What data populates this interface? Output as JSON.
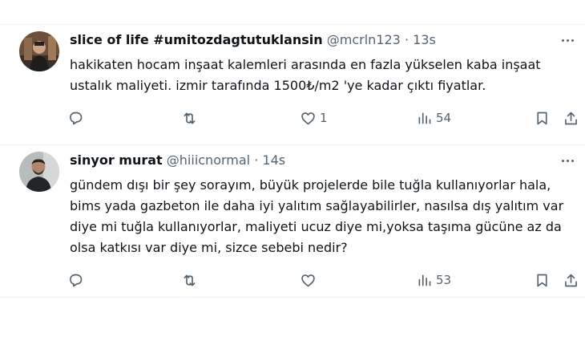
{
  "tweets": [
    {
      "display_name": "slice of life #umitozdagtutuklansin",
      "handle": "@mcrln123",
      "dot": "·",
      "time": "13s",
      "text_line1": "hakikaten hocam inşaat kalemleri arasında en fazla yükselen kaba inşaat",
      "text_line2": "ustalık maliyeti. izmir tarafında 1500₺/m2 'ye kadar çıktı fiyatlar.",
      "replies": "",
      "retweets": "",
      "likes": "1",
      "views": "54"
    },
    {
      "display_name": "sinyor murat",
      "handle": "@hiiicnormal",
      "dot": "·",
      "time": "14s",
      "text_line1": "gündem dışı bir şey sorayım, büyük projelerde bile tuğla kullanıyorlar hala,",
      "text_line2": "bims yada gazbeton ile daha iyi yalıtım sağlayabilirler, nasılsa dış yalıtım var",
      "text_line3": "diye mi tuğla kullanıyorlar, maliyeti ucuz diye mi,yoksa taşıma gücüne az da",
      "text_line4": "olsa katkısı var diye mi, sizce sebebi nedir?",
      "replies": "",
      "retweets": "",
      "likes": "",
      "views": "53"
    }
  ],
  "icons": {
    "reply": "reply-icon",
    "retweet": "retweet-icon",
    "like": "heart-icon",
    "views": "views-icon",
    "bookmark": "bookmark-icon",
    "share": "share-icon",
    "more": "more-icon"
  },
  "colors": {
    "text": "#0f1419",
    "secondary": "#536471",
    "divider": "#eff3f4"
  }
}
